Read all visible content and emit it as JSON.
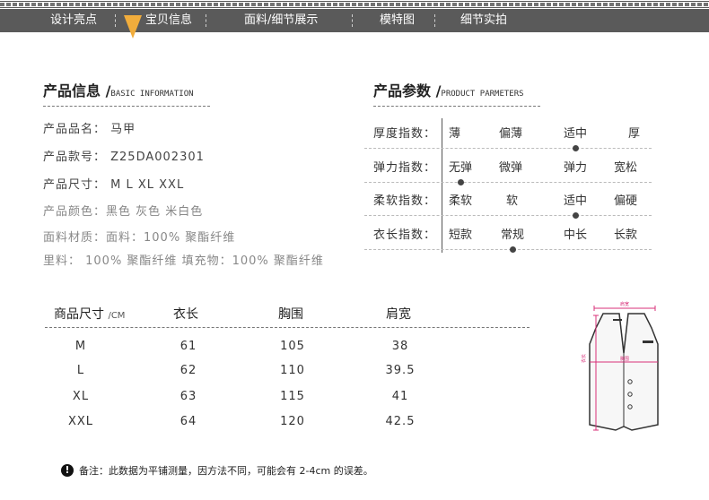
{
  "nav": {
    "items": [
      "设计亮点",
      "宝贝信息",
      "面料/细节展示",
      "模特图",
      "细节实拍"
    ],
    "active_index": 1,
    "accent_color": "#f1ad3c",
    "bar_color": "#5a5a5a"
  },
  "product_info": {
    "title": "产品信息 /",
    "title_en": "BASIC INFORMATION",
    "rows": [
      "产品品名： 马甲",
      "产品款号： Z25DA002301",
      "产品尺寸： M L XL XXL",
      "产品颜色：黑色 灰色 米白色",
      "面料材质：面料：100% 聚酯纤维",
      "里料： 100% 聚酯纤维 填充物：100% 聚酯纤维"
    ]
  },
  "product_params": {
    "title": "产品参数 /",
    "title_en": "PRODUCT PARMETERS",
    "rows": [
      {
        "label": "厚度指数：",
        "options": [
          "薄",
          "偏薄",
          "适中",
          "厚"
        ],
        "selected": 2
      },
      {
        "label": "弹力指数：",
        "options": [
          "无弹",
          "微弹",
          "弹力",
          "宽松"
        ],
        "selected": 0
      },
      {
        "label": "柔软指数：",
        "options": [
          "柔软",
          "软",
          "适中",
          "偏硬"
        ],
        "selected": 2
      },
      {
        "label": "衣长指数：",
        "options": [
          "短款",
          "常规",
          "中长",
          "长款"
        ],
        "selected": 1
      }
    ]
  },
  "size_table": {
    "headers": [
      "商品尺寸",
      "衣长",
      "胸围",
      "肩宽"
    ],
    "unit": "/CM",
    "rows": [
      [
        "M",
        "61",
        "105",
        "38"
      ],
      [
        "L",
        "62",
        "110",
        "39.5"
      ],
      [
        "XL",
        "63",
        "115",
        "41"
      ],
      [
        "XXL",
        "64",
        "120",
        "42.5"
      ]
    ]
  },
  "diagram": {
    "shoulder_label": "肩宽",
    "chest_label": "胸围",
    "length_label": "衣长",
    "measure_color": "#d9307a"
  },
  "note": {
    "icon": "exclamation-icon",
    "text": "备注：此数据为平铺测量，因方法不同，可能会有 2-4cm 的误差。"
  }
}
